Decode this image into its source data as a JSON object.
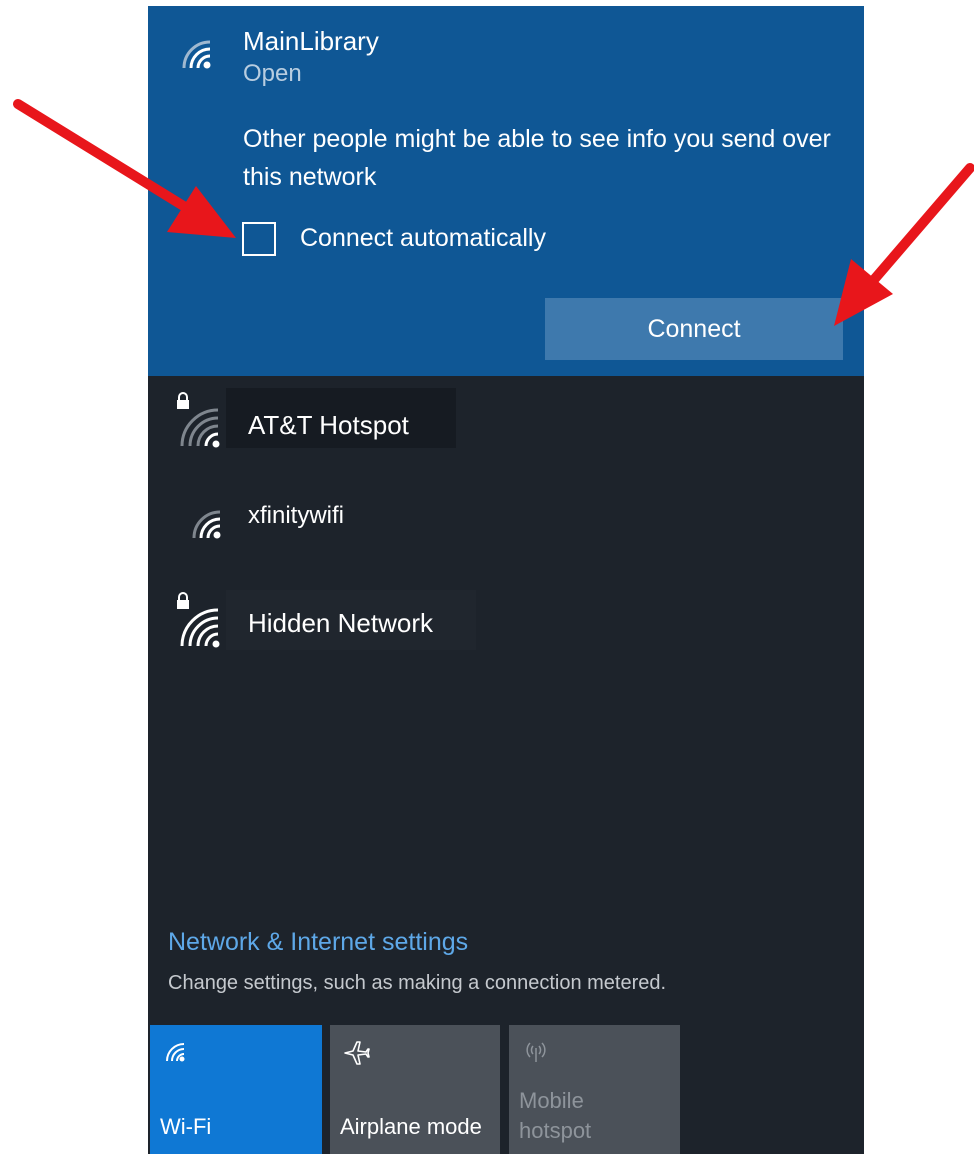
{
  "selected_network": {
    "name": "MainLibrary",
    "status": "Open",
    "warning": "Other people might be able to see info you send over this network",
    "connect_automatically_label": "Connect automatically",
    "connect_automatically_checked": false,
    "connect_button_label": "Connect",
    "icon": "wifi-icon"
  },
  "networks": [
    {
      "name": "AT&T Hotspot",
      "secured": true,
      "icon": "wifi-secured-icon"
    },
    {
      "name": "xfinitywifi",
      "secured": false,
      "icon": "wifi-icon"
    },
    {
      "name": "Hidden Network",
      "secured": true,
      "icon": "wifi-secured-icon"
    }
  ],
  "settings": {
    "title": "Network & Internet settings",
    "subtitle": "Change settings, such as making a connection metered."
  },
  "quick_actions": [
    {
      "label": "Wi-Fi",
      "icon": "wifi-icon",
      "state": "on"
    },
    {
      "label": "Airplane mode",
      "icon": "airplane-icon",
      "state": "off"
    },
    {
      "label_line1": "Mobile",
      "label_line2": "hotspot",
      "icon": "mobile-hotspot-icon",
      "state": "disabled"
    }
  ],
  "colors": {
    "selected_bg": "#0f5795",
    "panel_bg": "#1d232b",
    "accent": "#0f78d4",
    "link": "#5ea8e8",
    "annotation_arrow": "#e8161b"
  }
}
